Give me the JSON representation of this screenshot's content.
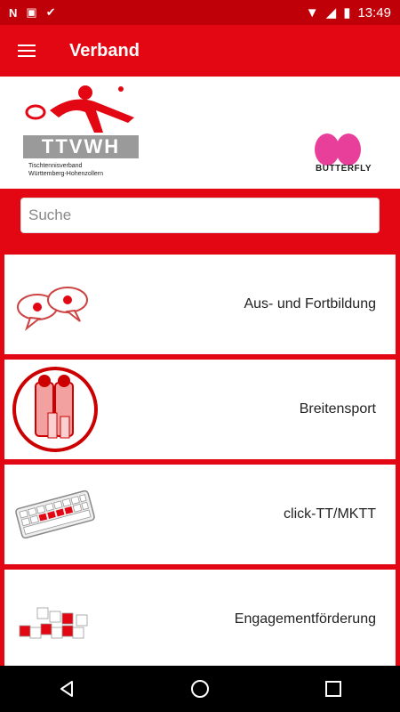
{
  "status_bar": {
    "time": "13:49"
  },
  "app_bar": {
    "title": "Verband"
  },
  "banner": {
    "left_logo_text": "TTVWH",
    "left_logo_sub1": "Tischtennisverband",
    "left_logo_sub2": "Württemberg-Hohenzollern",
    "right_logo_text": "BUTTERFLY"
  },
  "search": {
    "placeholder": "Suche",
    "value": ""
  },
  "items": [
    {
      "label": "Aus- und Fortbildung",
      "icon": "speech-bubbles-icon"
    },
    {
      "label": "Breitensport",
      "icon": "family-icon"
    },
    {
      "label": "click-TT/MKTT",
      "icon": "keyboard-icon"
    },
    {
      "label": "Engagementförderung",
      "icon": "letter-cubes-icon"
    }
  ],
  "colors": {
    "brand_red": "#e30613"
  }
}
